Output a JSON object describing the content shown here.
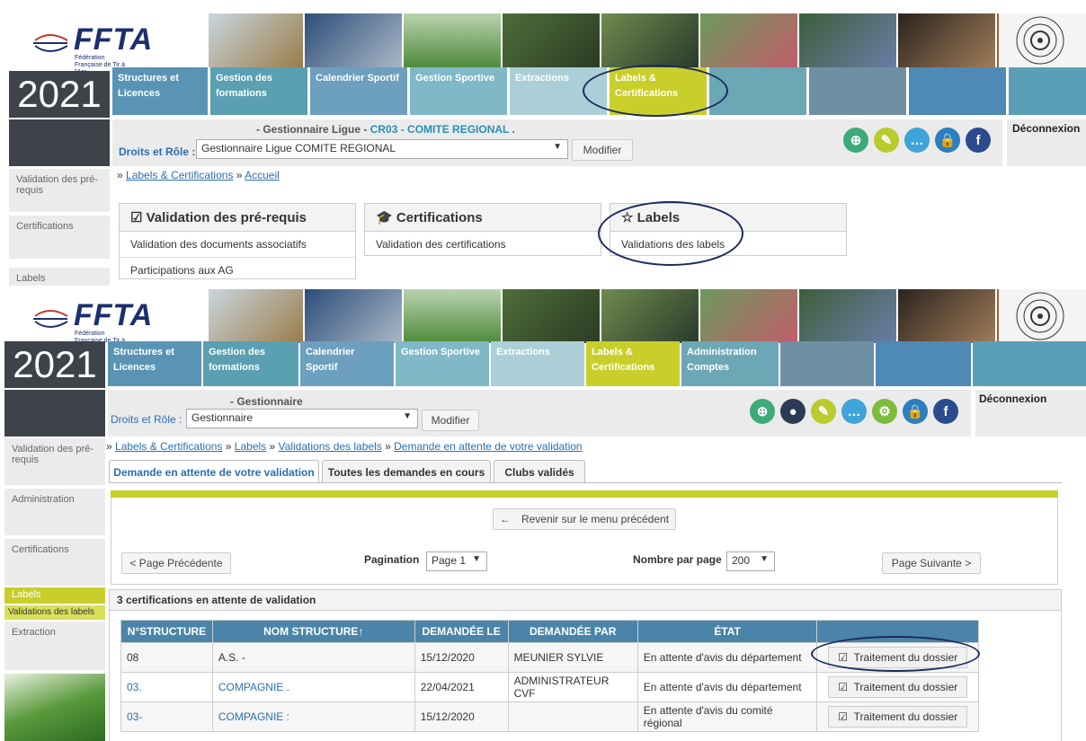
{
  "top": {
    "logo": "FFTA",
    "logo_sub": "Fédération Française de Tir à l'Arc",
    "year": "2021",
    "nav": [
      "Structures et Licences",
      "Gestion des formations",
      "Calendrier Sportif",
      "Gestion Sportive",
      "Extractions",
      "Labels & Certifications"
    ],
    "info_prefix": "- Gestionnaire Ligue -",
    "info_code": "CR03 - COMITE REGIONAL",
    "info_suffix": ".",
    "role_label": "Droits et Rôle :",
    "role_value": "Gestionnaire Ligue COMITE REGIONAL",
    "modify": "Modifier",
    "logout": "Déconnexion",
    "side": [
      "Validation des pré-requis",
      "Certifications",
      "Labels"
    ],
    "breadcrumb": [
      "»",
      "Labels & Certifications",
      "»",
      "Accueil"
    ],
    "panels": [
      {
        "title": "Validation des pré-requis",
        "icon": "edit-icon",
        "rows": [
          "Validation des documents associatifs",
          "Participations aux AG"
        ]
      },
      {
        "title": "Certifications",
        "icon": "graduation-cap-icon",
        "rows": [
          "Validation des certifications"
        ]
      },
      {
        "title": "Labels",
        "icon": "star-icon",
        "rows": [
          "Validations des labels"
        ]
      }
    ]
  },
  "bottom": {
    "logo": "FFTA",
    "logo_sub": "Fédération Française de Tir à l'Arc",
    "year": "2021",
    "nav": [
      "Structures et Licences",
      "Gestion des formations",
      "Calendrier Sportif",
      "Gestion Sportive",
      "Extractions",
      "Labels & Certifications",
      "Administration Comptes"
    ],
    "info": "- Gestionnaire",
    "role_label": "Droits et Rôle :",
    "role_value": "Gestionnaire",
    "modify": "Modifier",
    "logout": "Déconnexion",
    "side": [
      "Validation des pré-requis",
      "Administration",
      "Certifications",
      "Labels",
      "Validations des labels",
      "Extraction"
    ],
    "breadcrumb": [
      "»",
      "Labels & Certifications",
      "»",
      "Labels",
      "»",
      "Validations des labels",
      "»",
      "Demande en attente de votre validation"
    ],
    "tabs": [
      "Demande en attente de votre validation",
      "Toutes les demandes en cours",
      "Clubs validés"
    ],
    "back_button": "Revenir sur le menu précédent",
    "prev_page": "< Page Précédente",
    "pagination_label": "Pagination",
    "page_value": "Page 1",
    "per_page_label": "Nombre par page",
    "per_page_value": "200",
    "next_page": "Page Suivante >",
    "count_title": "3 certifications en attente de validation",
    "table": {
      "headers": [
        "N°STRUCTURE",
        "NOM STRUCTURE↑",
        "DEMANDÉE LE",
        "DEMANDÉE PAR",
        "ÉTAT",
        ""
      ],
      "rows": [
        [
          "08",
          "A.S. -",
          "15/12/2020",
          "MEUNIER SYLVIE",
          "En attente d'avis du département",
          "Traitement du dossier"
        ],
        [
          "03.",
          "COMPAGNIE .",
          "22/04/2021",
          "ADMINISTRATEUR CVF",
          "En attente d'avis du département",
          "Traitement du dossier"
        ],
        [
          "03-",
          "COMPAGNIE :",
          "15/12/2020",
          "",
          "En attente d'avis du comité régional",
          "Traitement du dossier"
        ]
      ]
    }
  },
  "colors": {
    "nav_teal": "#5a9ab5",
    "nav_active": "#c8cf2a",
    "header_blue": "#4a85a9",
    "year_bg": "#3e4249"
  }
}
